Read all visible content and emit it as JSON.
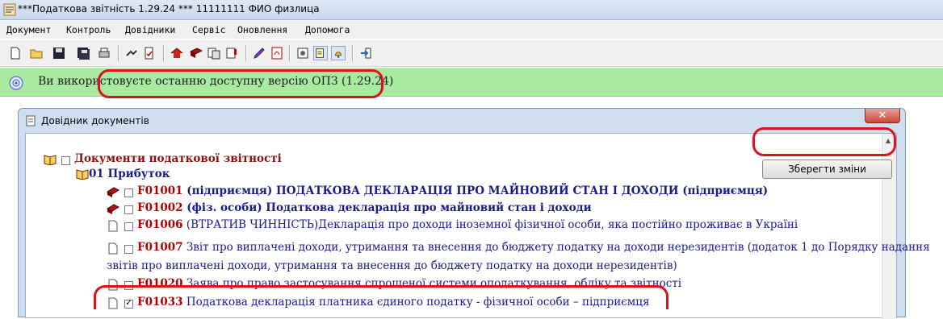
{
  "window": {
    "title": "***Податкова звітність 1.29.24 *** 11111111 ФИО физлица"
  },
  "menu": {
    "items": [
      "Документ",
      "Контроль",
      "Довідники",
      "Сервіс",
      "Оновлення",
      "Допомога"
    ]
  },
  "toolbar": {
    "buttons": [
      "new-document-icon",
      "open-folder-icon",
      "save-icon",
      "save-all-icon",
      "print-icon",
      "arrows-icon",
      "document-check-icon",
      "home-icon",
      "book-icon",
      "copy-icon",
      "document-alert-icon",
      "edit-icon",
      "pdf-icon",
      "settings-icon",
      "notes-icon",
      "bell-icon",
      "exit-icon"
    ]
  },
  "info": {
    "text": "Ви використовуєте останню доступну версію ОПЗ (1.29.24)"
  },
  "dialog": {
    "title": "Довідник документів",
    "close_label": "✕",
    "save_label": "Зберегти зміни",
    "root": {
      "label": "Документи податкової звітності"
    },
    "group": {
      "label": "01 Прибуток"
    },
    "rows": [
      {
        "code": "F01001",
        "text": " (підприємця) ПОДАТКОВА ДЕКЛАРАЦІЯ ПРО МАЙНОВИЙ СТАН І ДОХОДИ (підприємця)",
        "checked": false,
        "style": "bold"
      },
      {
        "code": "F01002",
        "text": " (фіз. особи) Податкова декларація про майновий стан і доходи",
        "checked": false,
        "style": "bold"
      },
      {
        "code": "F01006",
        "text": " (ВТРАТИВ ЧИННІСТЬ)Декларація про доходи іноземної фізичної особи, яка постійно проживає в Україні",
        "checked": false,
        "style": "normal"
      },
      {
        "code": "F01007",
        "text": " Звіт про виплачені доходи, утримання та внесення до бюджету податку на доходи нерезидентів (додаток 1 до Порядку надання",
        "text2": "звітів про виплачені доходи, утримання та внесення до бюджету податку на доходи нерезидентів)",
        "checked": false,
        "style": "normal"
      },
      {
        "code": "F01020",
        "text": " Заява про право застосування спрощеної системи оподаткування, обліку та звітності",
        "checked": false,
        "style": "normal"
      },
      {
        "code": "F01033",
        "text": " Податкова декларація платника єдиного податку - фізичної особи – підприємця",
        "checked": true,
        "style": "normal"
      }
    ]
  },
  "colors": {
    "info_bg": "#a9eaa1",
    "highlight": "#e0101e",
    "code_red": "#b00000",
    "text_navy": "#1a1a8c"
  }
}
